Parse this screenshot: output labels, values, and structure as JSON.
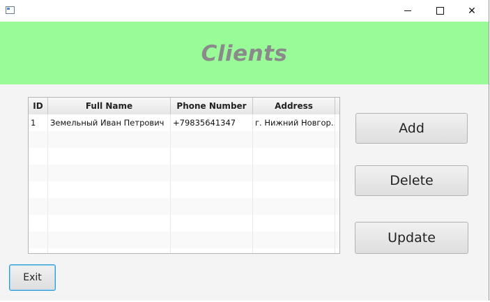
{
  "window": {
    "title": "",
    "controls": {
      "minimize": "minimize-icon",
      "maximize": "maximize-icon",
      "close": "close-icon"
    },
    "close_glyph": "✕"
  },
  "header": {
    "title": "Clients",
    "background": "#98fb98"
  },
  "table": {
    "columns": [
      "ID",
      "Full Name",
      "Phone Number",
      "Address"
    ],
    "rows": [
      {
        "id": "1",
        "full_name": "Земельный Иван Петрович",
        "phone": "+79835641347",
        "address": "г. Нижний Новгор..."
      }
    ]
  },
  "buttons": {
    "add": "Add",
    "delete": "Delete",
    "update": "Update",
    "exit": "Exit"
  },
  "colors": {
    "focus_border": "#2f9bd5"
  }
}
